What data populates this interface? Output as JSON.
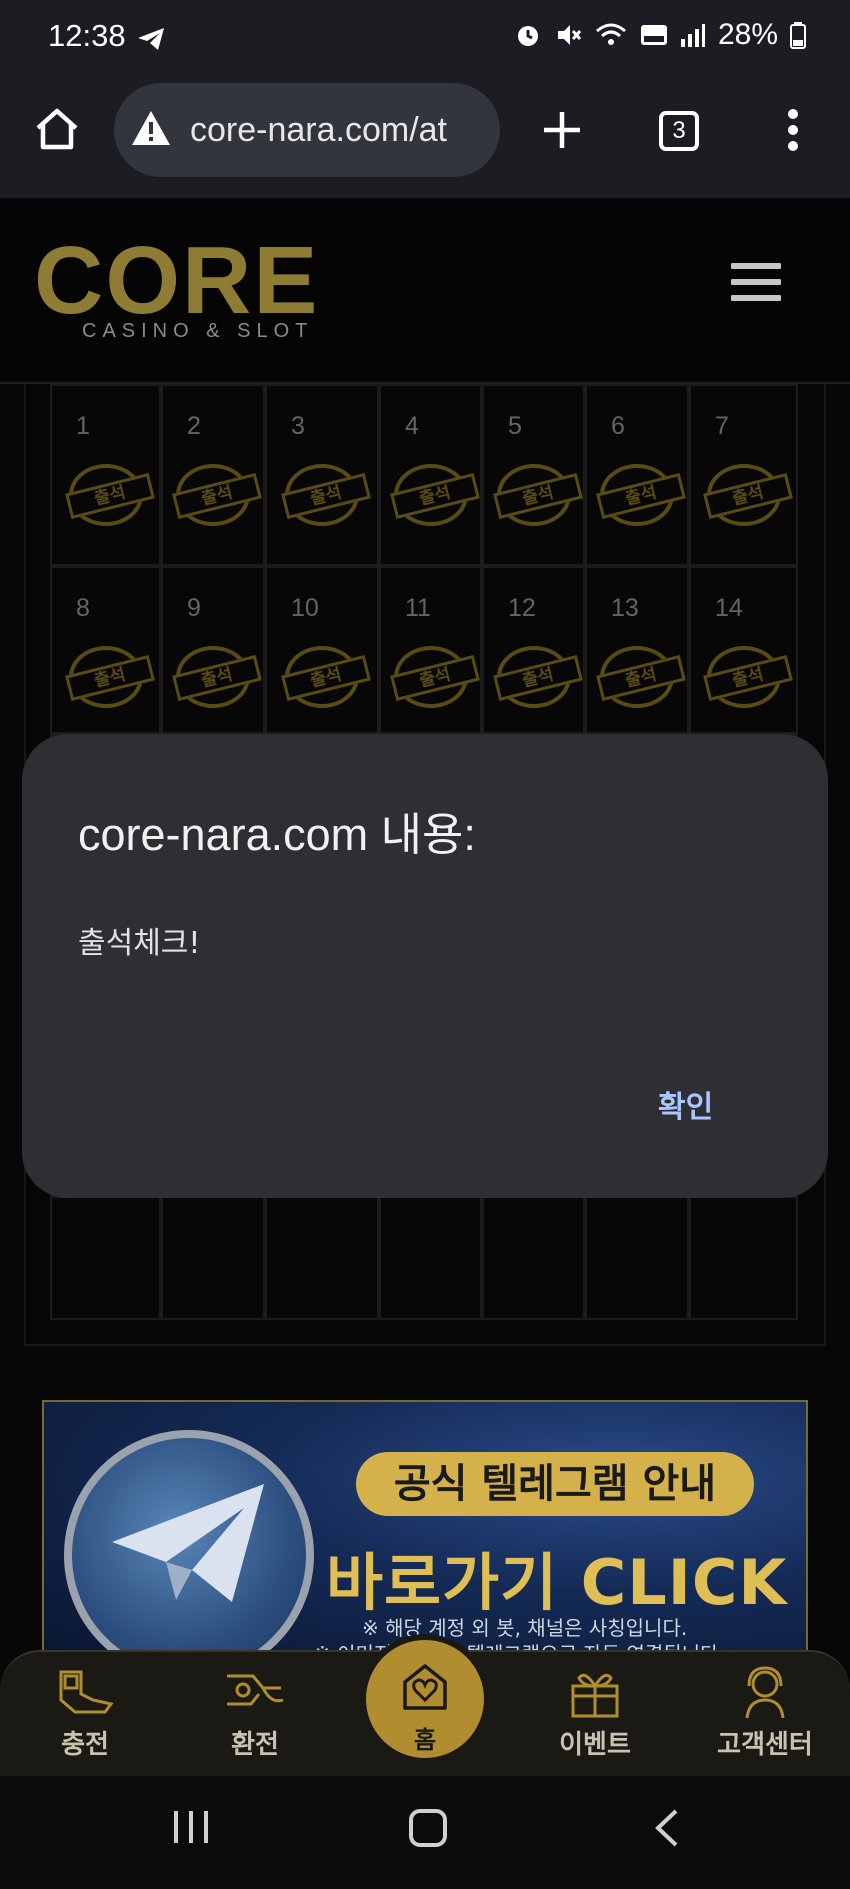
{
  "status_bar": {
    "time": "12:38",
    "battery": "28%",
    "icons": [
      "telegram-icon",
      "alarm-icon",
      "mute-icon",
      "wifi-icon",
      "hd-voice-icon",
      "signal-icon",
      "battery-icon"
    ]
  },
  "browser": {
    "url": "core-nara.com/at",
    "tab_count": "3"
  },
  "site": {
    "logo_main": "CORE",
    "logo_sub": "CASINO & SLOT"
  },
  "calendar": {
    "stamp_label": "출석",
    "days": [
      "1",
      "2",
      "3",
      "4",
      "5",
      "6",
      "7",
      "8",
      "9",
      "10",
      "11",
      "12",
      "13",
      "14"
    ]
  },
  "dialog": {
    "title": "core-nara.com 내용:",
    "message": "출석체크!",
    "ok_label": "확인"
  },
  "banner": {
    "pill": "공식 텔레그램 안내",
    "headline": "바로가기 CLICK",
    "note1": "※ 해당 계정 외 봇, 채널은 사칭입니다.",
    "note2": "※ 이미지 클릭 시 텔레그램으로 자동 연결됩니다."
  },
  "bottom_nav": {
    "charge": "충전",
    "exchange": "환전",
    "home": "홈",
    "event": "이벤트",
    "support": "고객센터"
  },
  "colors": {
    "gold": "#b08d2e",
    "dialog_bg": "#2e2e33",
    "ok_blue": "#a9c7ff"
  }
}
